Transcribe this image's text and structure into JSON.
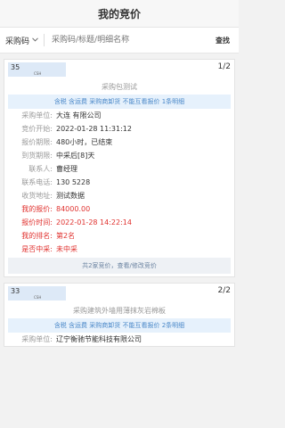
{
  "header": {
    "title": "我的竞价"
  },
  "search": {
    "type_label": "采购码",
    "placeholder": "采购码/标题/明细名称",
    "button_label": "查找"
  },
  "cards": [
    {
      "number": "35",
      "unit": "CSH",
      "page": "1/2",
      "subtitle": "采购包测试",
      "notice": "含税 含运费 采购商卸货 不能互看报价 1条明细",
      "rows": [
        {
          "label": "采购单位:",
          "value": "大连                    有限公司"
        },
        {
          "label": "竞价开始:",
          "value": "2022-01-28 11:31:12"
        },
        {
          "label": "报价期限:",
          "value": "480小时，已结束"
        },
        {
          "label": "到货期限:",
          "value": "中采后[8]天"
        },
        {
          "label": "联系人:",
          "value": "曹经理"
        },
        {
          "label": "联系电话:",
          "value": "130         5228"
        },
        {
          "label": "收货地址:",
          "value": "测试数据"
        },
        {
          "label": "我的报价:",
          "value": "84000.00"
        },
        {
          "label": "报价时间:",
          "value": "2022-01-28 14:22:14"
        },
        {
          "label": "我的排名:",
          "value": "第2名"
        },
        {
          "label": "是否中采:",
          "value": "未中采"
        }
      ],
      "footer": "共2家竞价，查看/修改竞价"
    },
    {
      "number": "33",
      "unit": "CSH",
      "page": "2/2",
      "subtitle": "采购建筑外墙用薄抹灰岩棉板",
      "notice": "含税 含运费 采购商卸货 不能互看报价 2条明细",
      "rows": [
        {
          "label": "采购单位:",
          "value": "辽宁衡驰节能科技有限公司"
        }
      ]
    }
  ]
}
